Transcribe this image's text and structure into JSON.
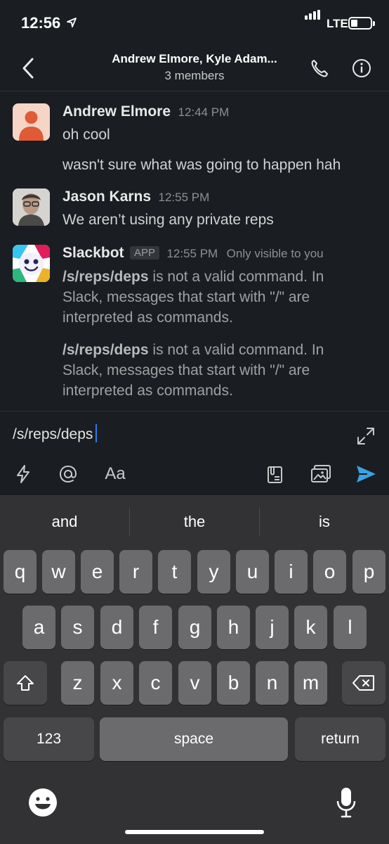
{
  "status_bar": {
    "time": "12:56",
    "network": "LTE"
  },
  "header": {
    "title": "Andrew Elmore, Kyle Adam...",
    "subtitle": "3 members"
  },
  "messages": [
    {
      "author": "Andrew Elmore",
      "time": "12:44 PM",
      "lines": [
        "oh cool",
        "wasn't sure what was going to happen hah"
      ]
    },
    {
      "author": "Jason Karns",
      "time": "12:55 PM",
      "lines": [
        "We aren’t using any private reps"
      ]
    },
    {
      "author": "Slackbot",
      "badge": "APP",
      "time": "12:55 PM",
      "visibility": "Only visible to you",
      "blocks": [
        {
          "command": "/s/reps/deps",
          "line1": " is not a valid command. In",
          "line2": "Slack, messages that start with \"/\" are",
          "line3": "interpreted as commands."
        },
        {
          "command": "/s/reps/deps",
          "line1": " is not a valid command. In",
          "line2": "Slack, messages that start with \"/\" are",
          "line3": "interpreted as commands."
        }
      ]
    }
  ],
  "composer": {
    "value": "/s/reps/deps",
    "tools": [
      "lightning-icon",
      "at-icon",
      "format-text-icon",
      "clipboard-icon",
      "image-icon",
      "send-icon"
    ],
    "format_label": "Aa"
  },
  "keyboard": {
    "suggestions": [
      "and",
      "the",
      "is"
    ],
    "row1": [
      "q",
      "w",
      "e",
      "r",
      "t",
      "y",
      "u",
      "i",
      "o",
      "p"
    ],
    "row2": [
      "a",
      "s",
      "d",
      "f",
      "g",
      "h",
      "j",
      "k",
      "l"
    ],
    "row3": [
      "z",
      "x",
      "c",
      "v",
      "b",
      "n",
      "m"
    ],
    "numbers_label": "123",
    "space_label": "space",
    "return_label": "return"
  },
  "colors": {
    "background": "#1a1d21",
    "accent": "#2d7ce4",
    "send": "#3aa3e3"
  }
}
